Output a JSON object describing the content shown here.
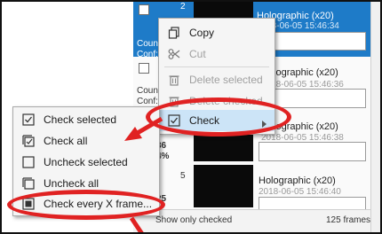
{
  "colors": {
    "accent": "#1e7bc8",
    "highlight_ellipse": "#e02222",
    "selected_row": "#1e7bc8"
  },
  "rows": [
    {
      "number": "2",
      "title": "Holographic (x20)",
      "date": "2018-06-05 15:46:34",
      "count_label": "Count:",
      "conf_label": "Conf:"
    },
    {
      "number": "",
      "title": "Holographic (x20)",
      "date": "2018-06-05 15:46:36",
      "count_label": "Count:",
      "conf_label": "Conf:"
    },
    {
      "number": "",
      "title": "Holographic (x20)",
      "date": "2018-06-05 15:46:38",
      "count_value": "36",
      "conf_value": "4%"
    },
    {
      "number": "5",
      "title": "Holographic (x20)",
      "date": "2018-06-05 15:46:40",
      "count_value": "25"
    }
  ],
  "context_menu": {
    "items": [
      {
        "label": "Copy",
        "icon": "copy-icon",
        "enabled": true
      },
      {
        "label": "Cut",
        "icon": "scissors-icon",
        "enabled": false
      },
      {
        "label": "Delete selected",
        "icon": "trash-icon",
        "enabled": false
      },
      {
        "label": "Delete checked",
        "icon": "trash-icon",
        "enabled": false
      },
      {
        "label": "Check",
        "icon": "checkbox-icon",
        "enabled": true,
        "submenu": true
      }
    ]
  },
  "submenu": {
    "items": [
      {
        "label": "Check selected",
        "icon": "checkbox-checked-icon"
      },
      {
        "label": "Check all",
        "icon": "check-all-icon"
      },
      {
        "label": "Uncheck selected",
        "icon": "checkbox-empty-icon"
      },
      {
        "label": "Uncheck all",
        "icon": "uncheck-all-icon"
      },
      {
        "label": "Check every X frame...",
        "icon": "frame-icon"
      }
    ]
  },
  "footer": {
    "show_only_checked": "Show only checked",
    "frame_count": "125 frames"
  }
}
